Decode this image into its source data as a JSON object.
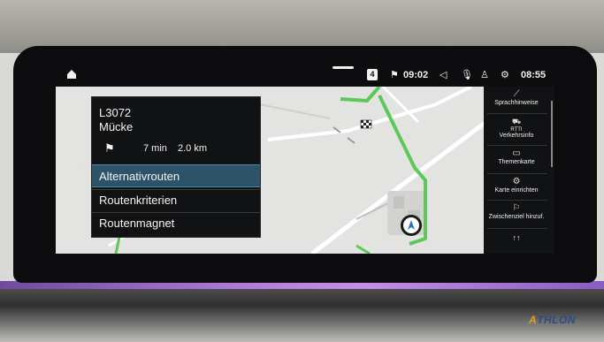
{
  "statusbar": {
    "home_icon": "home-icon",
    "badge": "4",
    "eta_time": "09:02",
    "clock": "08:55"
  },
  "route_panel": {
    "road": "L3072",
    "destination": "Mücke",
    "duration": "7 min",
    "distance": "2.0 km",
    "menu": [
      {
        "label": "Alternativrouten",
        "selected": true
      },
      {
        "label": "Routenkriterien",
        "selected": false
      },
      {
        "label": "Routenmagnet",
        "selected": false
      }
    ]
  },
  "sidebar": {
    "items": [
      {
        "label": "Sprachhinweise",
        "icon": "speaker-icon"
      },
      {
        "label": "Verkehrsinfo",
        "icon": "rtti-traffic-icon",
        "icon_text": "RTTI"
      },
      {
        "label": "Themenkarte",
        "icon": "map-theme-icon"
      },
      {
        "label": "Karte einrichten",
        "icon": "map-settings-icon"
      },
      {
        "label": "Zwischenziel hinzuf.",
        "icon": "add-waypoint-flag-icon"
      }
    ]
  },
  "colors": {
    "route": "#5cc85a",
    "selection": "#2d5368",
    "panel": "#111214",
    "map_bg": "#e3e3e1"
  },
  "watermark": {
    "text": "THLON",
    "letter": "A"
  }
}
